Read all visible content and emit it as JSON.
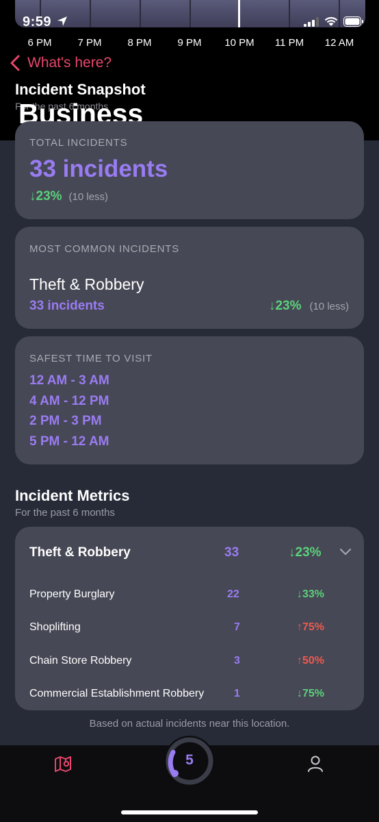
{
  "status": {
    "time": "9:59"
  },
  "timeline": {
    "hours": [
      "6 PM",
      "7 PM",
      "8 PM",
      "9 PM",
      "10 PM",
      "11 PM",
      "12 AM"
    ]
  },
  "nav": {
    "back_label": "What's here?"
  },
  "snapshot": {
    "title": "Incident Snapshot",
    "subtitle": "For the past 6 months",
    "overlay_title": "Business"
  },
  "total": {
    "label": "TOTAL INCIDENTS",
    "value": "33 incidents",
    "change": "↓23%",
    "change_note": "(10 less)"
  },
  "common": {
    "label": "MOST COMMON INCIDENTS",
    "category": "Theft & Robbery",
    "count": "33 incidents",
    "change": "↓23%",
    "change_note": "(10 less)"
  },
  "safest": {
    "label": "SAFEST TIME TO VISIT",
    "times": [
      "12 AM - 3 AM",
      "4 AM - 12 PM",
      "2 PM - 3 PM",
      "5 PM - 12 AM"
    ]
  },
  "metrics": {
    "title": "Incident Metrics",
    "subtitle": "For the past 6 months",
    "group": {
      "name": "Theft & Robbery",
      "count": "33",
      "change": "↓23%"
    },
    "rows": [
      {
        "name": "Property Burglary",
        "count": "22",
        "change": "↓33%",
        "direction": "down"
      },
      {
        "name": "Shoplifting",
        "count": "7",
        "change": "↑75%",
        "direction": "up"
      },
      {
        "name": "Chain Store Robbery",
        "count": "3",
        "change": "↑50%",
        "direction": "up"
      },
      {
        "name": "Commercial Establishment Robbery",
        "count": "1",
        "change": "↓75%",
        "direction": "down"
      }
    ],
    "footnote": "Based on actual incidents near this location."
  },
  "tabbar": {
    "center_badge": "5",
    "icons": [
      "map-pin-icon",
      "gauge-icon",
      "person-icon"
    ]
  },
  "colors": {
    "accent_purple": "#9a7cf2",
    "down_green": "#5bd17a",
    "up_red": "#ef5a4e",
    "back_pink": "#e9476b",
    "card_bg": "#464855",
    "page_bg": "#272b38"
  }
}
